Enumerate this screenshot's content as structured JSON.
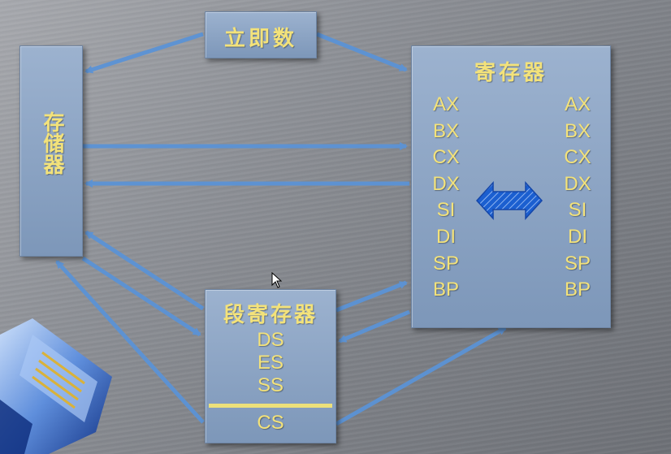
{
  "immediate": {
    "label": "立即数"
  },
  "memory": {
    "label": "存储器"
  },
  "registers": {
    "title": "寄存器",
    "left": [
      "AX",
      "BX",
      "CX",
      "DX",
      "SI",
      "DI",
      "SP",
      "BP"
    ],
    "right": [
      "AX",
      "BX",
      "CX",
      "DX",
      "SI",
      "DI",
      "SP",
      "BP"
    ]
  },
  "segment": {
    "title": "段寄存器",
    "items": [
      "DS",
      "ES",
      "SS"
    ],
    "cs": "CS"
  },
  "colors": {
    "arrow": "#5b93d6",
    "box": "#8aa3c4",
    "text": "#f3e27a",
    "double_arrow": "#1b5fd0"
  }
}
